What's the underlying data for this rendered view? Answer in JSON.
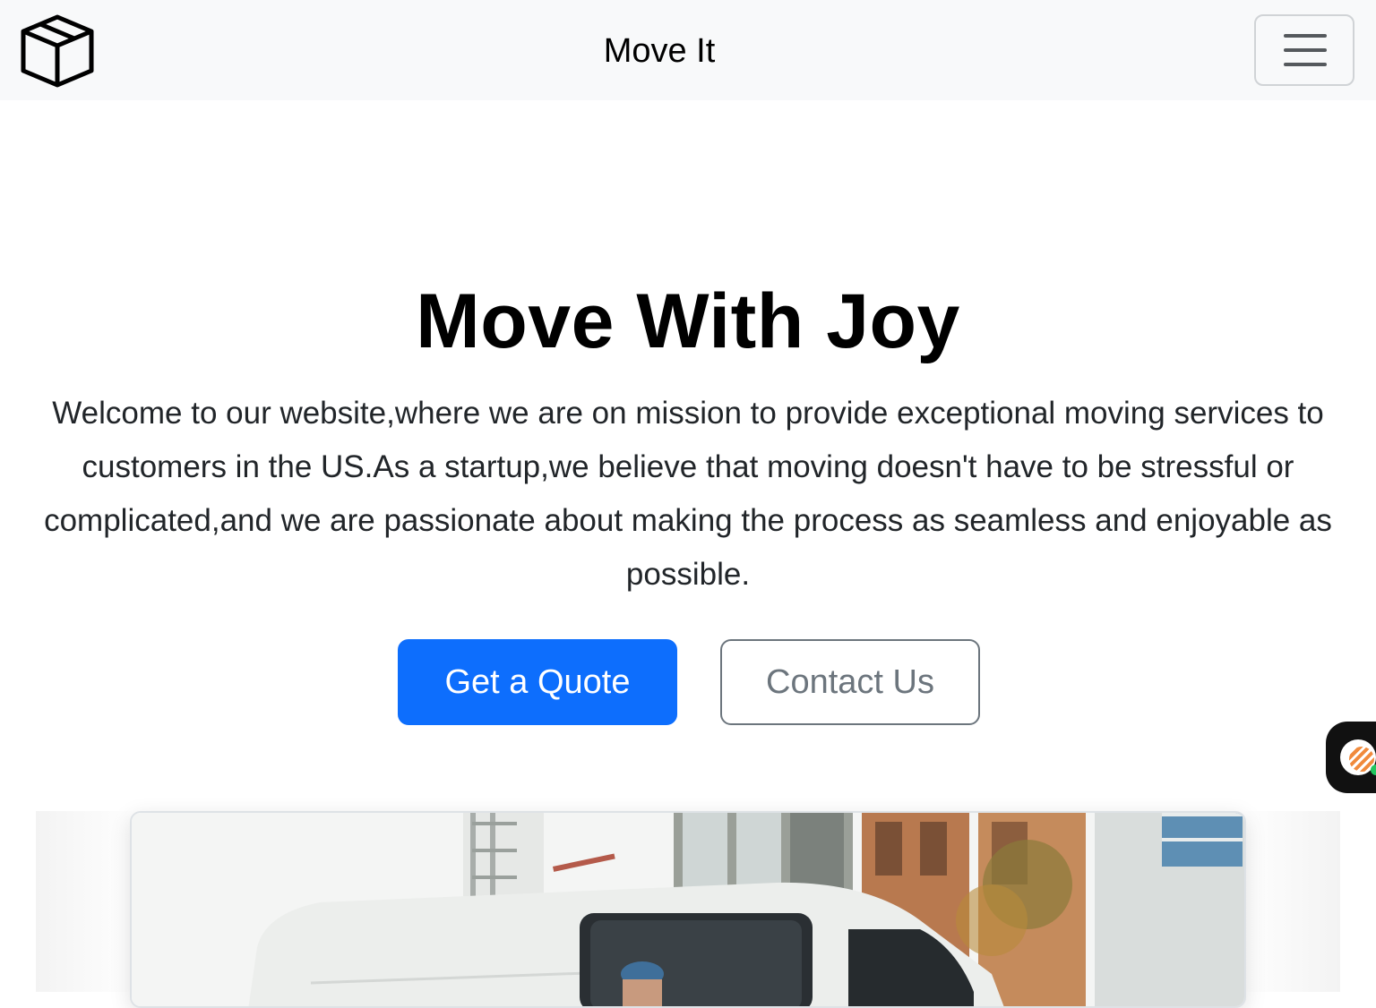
{
  "navbar": {
    "logo_icon": "box-icon",
    "title": "Move It",
    "toggler_icon": "hamburger-menu-icon"
  },
  "hero": {
    "title": "Move With Joy",
    "description": "Welcome to our website,where we are on mission to provide exceptional moving services to customers in the US.As a startup,we believe that moving doesn't have to be stressful or complicated,and we are passionate about making the process as seamless and enjoyable as possible.",
    "primary_button": "Get a Quote",
    "secondary_button": "Contact Us"
  },
  "colors": {
    "primary": "#0d6efd",
    "secondary": "#6c757d",
    "navbar_bg": "#f8f9fa"
  },
  "chat_widget": {
    "icon": "chat-support-icon"
  },
  "image": {
    "subject": "moving-van-photo"
  }
}
